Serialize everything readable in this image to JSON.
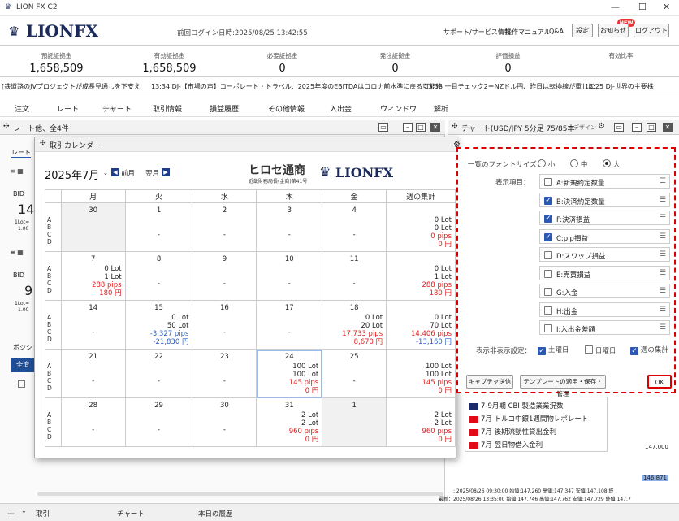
{
  "window": {
    "title": "LION FX C2",
    "min": "—",
    "max": "☐",
    "close": "✕"
  },
  "header": {
    "logo": "LIONFX",
    "login": "前回ログイン日時:2025/08/25 13:42:55",
    "links": [
      "サポート/サービス情報",
      "操作マニュアル",
      "Q&A"
    ],
    "buttons": [
      "設定",
      "お知らせ",
      "ログアウト"
    ],
    "new_badge": "NEW"
  },
  "account": [
    {
      "label": "預託証拠金",
      "value": "1,658,509"
    },
    {
      "label": "有効証拠金",
      "value": "1,658,509"
    },
    {
      "label": "必要証拠金",
      "value": "0"
    },
    {
      "label": "発注証拠金",
      "value": "0"
    },
    {
      "label": "評価損益",
      "value": "0"
    },
    {
      "label": "有効比率",
      "value": ""
    }
  ],
  "ticker": [
    "[鉄道路のJVプロジェクトが成長見通しを下支え",
    "13:34 DJ-【市場の声】コーポレート・トラベル、2025年度のEBITDAはコロナ前水準に戻る可能性",
    "13:33 一目チェック2＝NZドル円、昨日は転換線が重しに",
    "13:25 DJ-世界の主要株"
  ],
  "menu": [
    "注文",
    "レート",
    "チャート",
    "取引情報",
    "損益履歴",
    "その他情報",
    "入出金",
    "ウィンドウ",
    "解析"
  ],
  "left_panel": {
    "title": "レート他、全4件",
    "tab": "レート",
    "bid": "BID",
    "rate1": "14",
    "rate2": "9",
    "sub1": "1Lot=",
    "sub2": "1.00",
    "pos": "ポジショ",
    "all": "全済"
  },
  "calendar": {
    "title": "取引カレンダー",
    "month": "2025年7月",
    "prev": "前月",
    "next": "翌月",
    "hirose": "ヒロセ通商",
    "hirose_sub": "近畿財務局長(金商)第41号",
    "logo": "LIONFX",
    "headers": [
      "月",
      "火",
      "水",
      "木",
      "金",
      "週の集計"
    ],
    "rows": [
      [
        {
          "d": "30",
          "gray": true,
          "v": []
        },
        {
          "d": "1",
          "v": []
        },
        {
          "d": "2",
          "v": []
        },
        {
          "d": "3",
          "v": []
        },
        {
          "d": "4",
          "v": []
        },
        {
          "d": "",
          "v": [
            "0 Lot",
            "0 Lot",
            "0 pips",
            "0 円"
          ]
        }
      ],
      [
        {
          "d": "7",
          "v": [
            "0 Lot",
            "1 Lot",
            "288 pips",
            "180 円"
          ]
        },
        {
          "d": "8",
          "v": []
        },
        {
          "d": "9",
          "v": []
        },
        {
          "d": "10",
          "v": []
        },
        {
          "d": "11",
          "v": []
        },
        {
          "d": "",
          "v": [
            "0 Lot",
            "1 Lot",
            "288 pips",
            "180 円"
          ]
        }
      ],
      [
        {
          "d": "14",
          "v": []
        },
        {
          "d": "15",
          "v": [
            "0 Lot",
            "50 Lot",
            "-3,327 pips",
            "-21,830 円"
          ]
        },
        {
          "d": "16",
          "v": []
        },
        {
          "d": "17",
          "v": []
        },
        {
          "d": "18",
          "v": [
            "0 Lot",
            "20 Lot",
            "17,733 pips",
            "8,670 円"
          ]
        },
        {
          "d": "",
          "v": [
            "0 Lot",
            "70 Lot",
            "14,406 pips",
            "-13,160 円"
          ]
        }
      ],
      [
        {
          "d": "21",
          "v": []
        },
        {
          "d": "22",
          "v": []
        },
        {
          "d": "23",
          "v": []
        },
        {
          "d": "24",
          "sel": true,
          "v": [
            "100 Lot",
            "100 Lot",
            "145 pips",
            "0 円"
          ]
        },
        {
          "d": "25",
          "v": []
        },
        {
          "d": "",
          "v": [
            "100 Lot",
            "100 Lot",
            "145 pips",
            "0 円"
          ]
        }
      ],
      [
        {
          "d": "28",
          "v": []
        },
        {
          "d": "29",
          "v": []
        },
        {
          "d": "30",
          "v": []
        },
        {
          "d": "31",
          "v": [
            "2 Lot",
            "2 Lot",
            "960 pips",
            "0 円"
          ]
        },
        {
          "d": "1",
          "gray": true,
          "v": []
        },
        {
          "d": "",
          "v": [
            "2 Lot",
            "2 Lot",
            "960 pips",
            "0 円"
          ]
        }
      ]
    ]
  },
  "chart_panel": {
    "title": "チャート(USD/JPY 5分足 75/85本",
    "design": "デザイン"
  },
  "options": {
    "font_label": "一覧のフォントサイズ：",
    "sizes": [
      "小",
      "中",
      "大"
    ],
    "selected": "大",
    "items_label": "表示項目：",
    "items": [
      {
        "t": "A:新規約定数量",
        "c": false
      },
      {
        "t": "B:決済約定数量",
        "c": true
      },
      {
        "t": "F:決済損益",
        "c": true
      },
      {
        "t": "C:pip損益",
        "c": true
      },
      {
        "t": "D:スワップ損益",
        "c": false
      },
      {
        "t": "E:売買損益",
        "c": false
      },
      {
        "t": "G:入金",
        "c": false
      },
      {
        "t": "H:出金",
        "c": false
      },
      {
        "t": "I:入出金差額",
        "c": false
      }
    ],
    "hide_label": "表示非表示設定：",
    "hide": [
      {
        "t": "土曜日",
        "c": true
      },
      {
        "t": "日曜日",
        "c": false
      },
      {
        "t": "週の集計",
        "c": true
      }
    ],
    "capture": "キャプチャ送信",
    "template": "テンプレートの適用・保存・管理",
    "ok": "OK"
  },
  "news": [
    "7-9月期 CBI 製造業業況数",
    "7月 トルコ中銀1週間物レポレート",
    "7月 後期流動性貸出金利",
    "7月 翌日物借入金利"
  ],
  "chart_info": {
    "price1": "147.000",
    "price2": "146.871",
    "l1": ": 2025/08/26 09:30:00 始値:147.260 高値:147.347 安値:147.108 終",
    "l2": "最新：2025/08/26 13:35:00 始値:147.746 高値:147.762 安値:147.729 終値:147.7"
  },
  "status": {
    "tabs": [
      "取引",
      "チャート",
      "本日の履歴"
    ],
    "plus": "＋"
  }
}
